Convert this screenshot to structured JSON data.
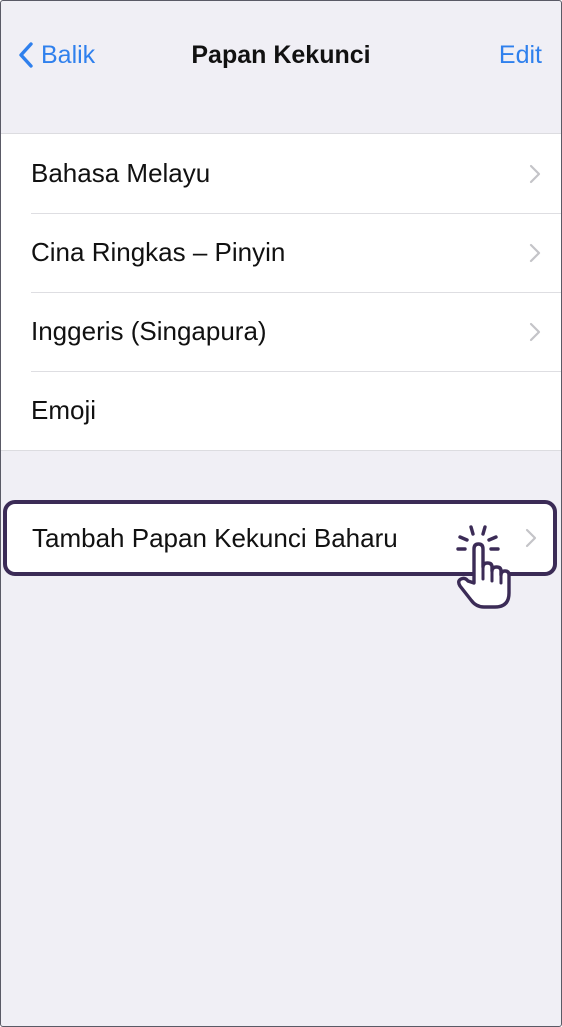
{
  "navbar": {
    "back_label": "Balik",
    "title": "Papan Kekunci",
    "edit_label": "Edit"
  },
  "keyboards": [
    {
      "label": "Bahasa Melayu",
      "has_chevron": true
    },
    {
      "label": "Cina Ringkas – Pinyin",
      "has_chevron": true
    },
    {
      "label": "Inggeris (Singapura)",
      "has_chevron": true
    },
    {
      "label": "Emoji",
      "has_chevron": false
    }
  ],
  "add_keyboard": {
    "label": "Tambah Papan Kekunci Baharu"
  },
  "icons": {
    "back": "chevron-left-icon",
    "disclosure": "chevron-right-icon",
    "tap_hint": "tap-hand-icon"
  },
  "colors": {
    "accent": "#2f80ed",
    "background": "#f0eff5",
    "highlight_border": "#3b2b56",
    "hand_color": "#3b2b56"
  }
}
